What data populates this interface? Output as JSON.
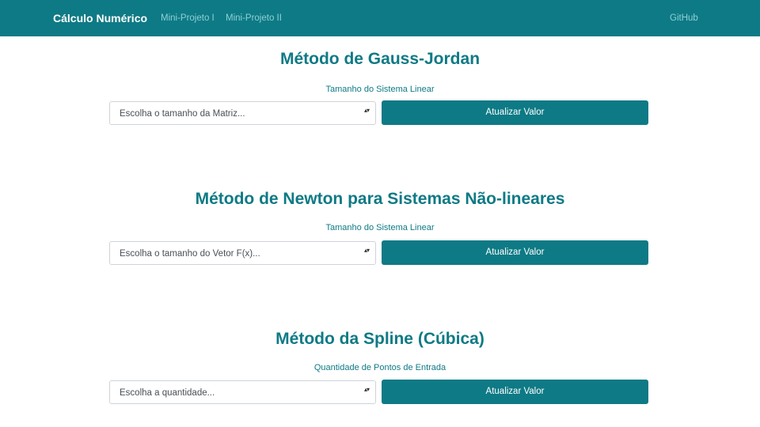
{
  "navbar": {
    "brand": "Cálculo Numérico",
    "links": [
      {
        "label": "Mini-Projeto I"
      },
      {
        "label": "Mini-Projeto II"
      }
    ],
    "github": "GitHub"
  },
  "sections": [
    {
      "title": "Método de Gauss-Jordan",
      "label": "Tamanho do Sistema Linear",
      "select_value": "Escolha o tamanho da Matriz...",
      "button": "Atualizar Valor"
    },
    {
      "title": "Método de Newton para Sistemas Não-lineares",
      "label": "Tamanho do Sistema Linear",
      "select_value": "Escolha o tamanho do Vetor F(x)...",
      "button": "Atualizar Valor"
    },
    {
      "title": "Método da Spline (Cúbica)",
      "label": "Quantidade de Pontos de Entrada",
      "select_value": "Escolha a quantidade...",
      "button": "Atualizar Valor"
    }
  ],
  "colors": {
    "primary": "#0e7a85",
    "nav_link": "#8fd0d6"
  },
  "icons": {
    "select_arrow": "sort-icon"
  }
}
